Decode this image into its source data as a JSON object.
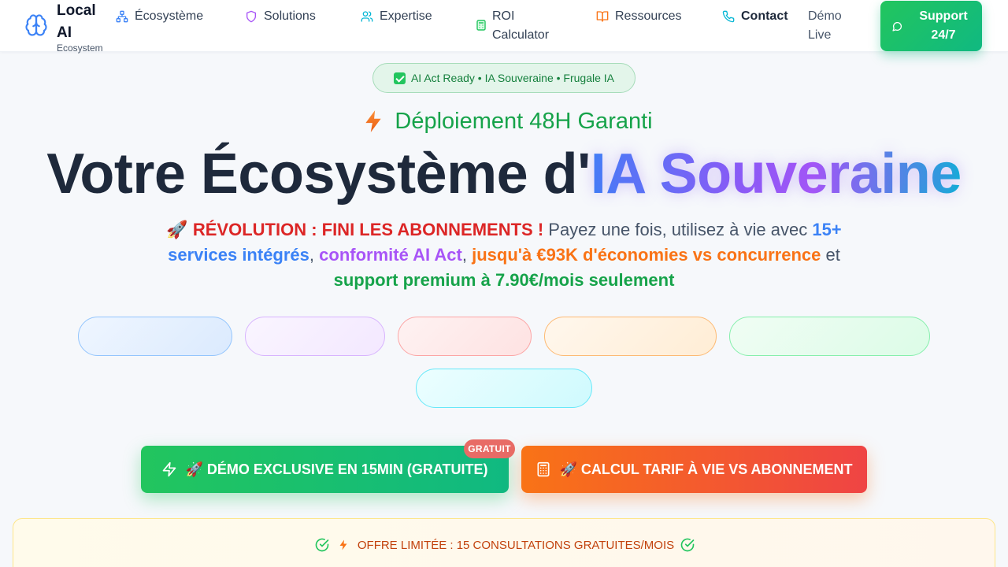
{
  "nav": {
    "brand_title": "Local AI",
    "brand_subtitle": "Ecosystem",
    "items": [
      {
        "label": "Écosystème",
        "icon": "network-icon"
      },
      {
        "label": "Solutions",
        "icon": "shield-icon"
      },
      {
        "label": "Expertise",
        "icon": "users-icon"
      },
      {
        "label": "ROI Calculator",
        "icon": "calculator-icon"
      },
      {
        "label": "Ressources",
        "icon": "book-icon"
      },
      {
        "label": "Contact",
        "icon": "phone-icon"
      }
    ],
    "demo_label": "Démo Live",
    "support_label": "Support 24/7"
  },
  "hero": {
    "badge": "AI Act Ready • IA Souveraine • Frugale IA",
    "deploy_text": "Déploiement 48H Garanti",
    "headline_main": "Votre Écosystème d'",
    "headline_highlight": "IA Souveraine",
    "sub": {
      "rocket": "🚀",
      "revolution": "RÉVOLUTION : FINI LES ABONNEMENTS !",
      "part1": " Payez une fois, utilisez à vie avec ",
      "services": "15+ services intégrés",
      "comma1": ", ",
      "compliance": "conformité AI Act",
      "comma2": ", ",
      "savings": "jusqu'à €93K d'économies vs concurrence",
      "et": " et ",
      "support": "support premium à 7.90€/mois seulement"
    }
  },
  "cta": {
    "demo_label": "🚀 DÉMO EXCLUSIVE EN 15MIN (GRATUITE)",
    "free_badge": "GRATUIT",
    "calc_label": "🚀 CALCUL TARIF À VIE VS ABONNEMENT"
  },
  "offer": {
    "text": "OFFRE LIMITÉE : 15 CONSULTATIONS GRATUITES/MOIS"
  },
  "colors": {
    "primary_green": "#22c55e",
    "accent_orange": "#f97316",
    "accent_red": "#ef4444",
    "headline_gradient": [
      "#3b82f6",
      "#8b5cf6",
      "#06b6d4"
    ]
  }
}
